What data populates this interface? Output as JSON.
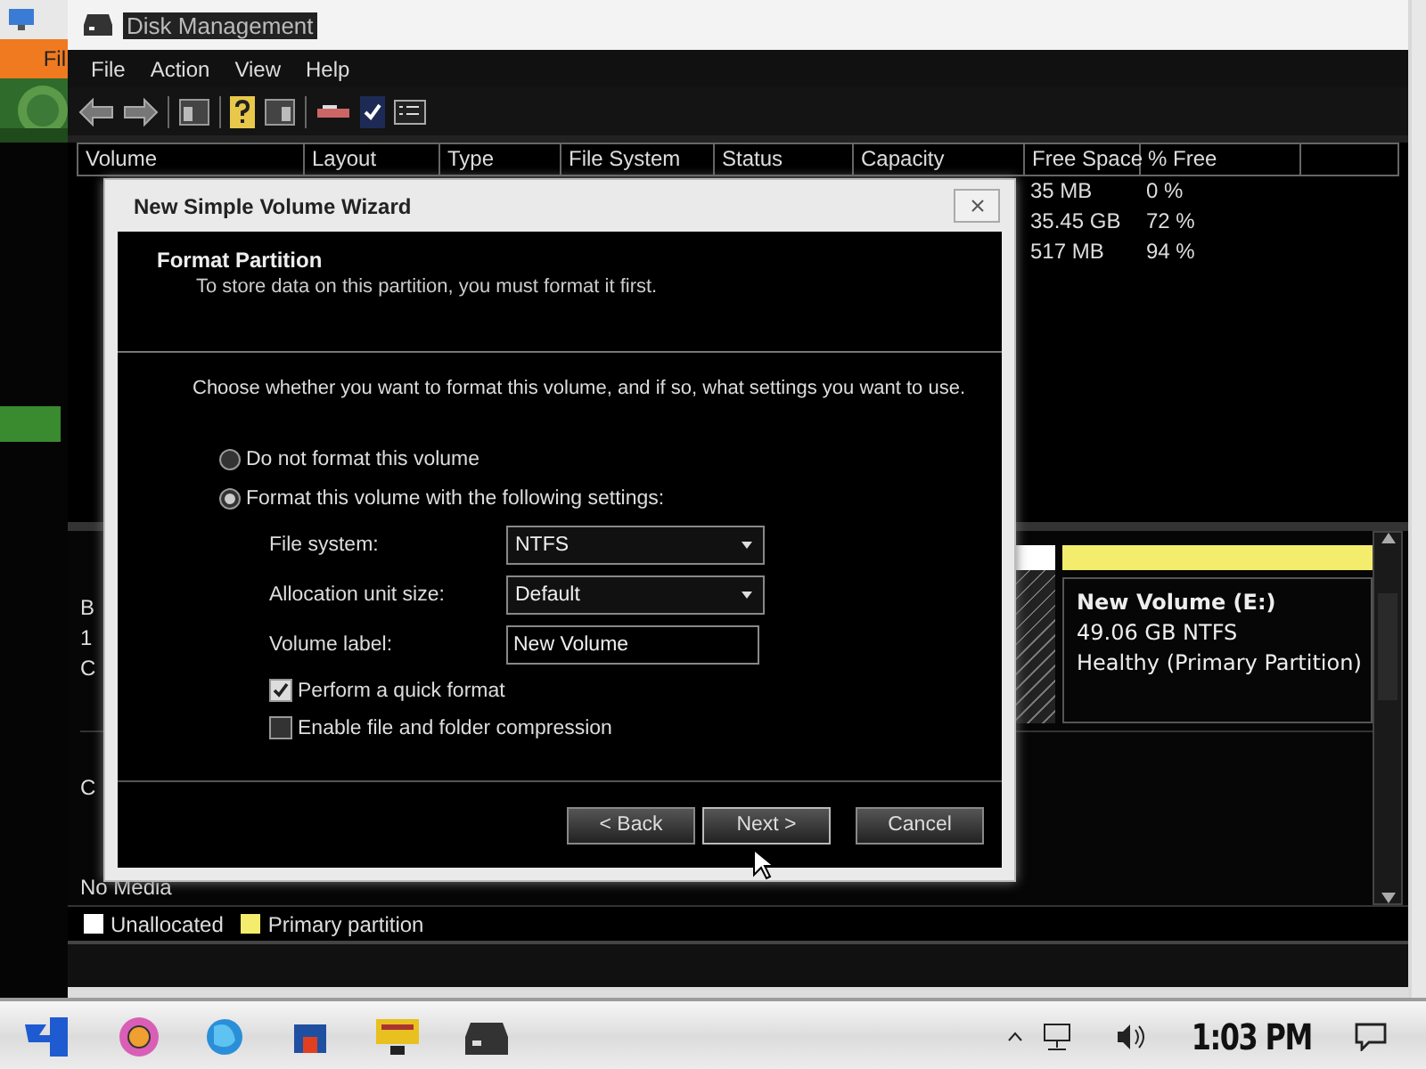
{
  "side_panel": {
    "tab_label": "Fil"
  },
  "window": {
    "title": "Disk Management"
  },
  "menu": [
    "File",
    "Action",
    "View",
    "Help"
  ],
  "volume_list": {
    "columns": [
      "Volume",
      "Layout",
      "Type",
      "File System",
      "Status",
      "Capacity",
      "Free Space",
      "% Free"
    ],
    "rows": [
      {
        "free_space": "35 MB",
        "percent_free": "0 %"
      },
      {
        "free_space": "35.45 GB",
        "percent_free": "72 %"
      },
      {
        "free_space": "517 MB",
        "percent_free": "94 %"
      }
    ]
  },
  "disks": [
    {
      "label_lines": [
        "B",
        "1",
        "C"
      ],
      "partitions": [
        {
          "kind": "unallocated"
        },
        {
          "kind": "primary",
          "name": "New Volume  (E:)",
          "size": "49.06 GB NTFS",
          "status": "Healthy (Primary Partition)"
        }
      ]
    },
    {
      "label_lines": [
        "C"
      ]
    }
  ],
  "no_media": "No Media",
  "legend": [
    {
      "label": "Unallocated",
      "color": "#ffffff"
    },
    {
      "label": "Primary partition",
      "color": "#f4ec6c"
    }
  ],
  "dialog": {
    "title": "New Simple Volume Wizard",
    "heading": "Format Partition",
    "subheading": "To store data on this partition, you must format it first.",
    "prompt": "Choose whether you want to format this volume, and if so, what settings you want to use.",
    "radios": [
      {
        "label": "Do not format this volume",
        "selected": false
      },
      {
        "label": "Format this volume with the following settings:",
        "selected": true
      }
    ],
    "settings": [
      {
        "kind": "dropdown",
        "label": "File system:",
        "value": "NTFS"
      },
      {
        "kind": "dropdown",
        "label": "Allocation unit size:",
        "value": "Default"
      },
      {
        "kind": "text",
        "label": "Volume label:",
        "value": "New Volume"
      }
    ],
    "checkboxes": [
      {
        "label": "Perform a quick format",
        "checked": true
      },
      {
        "label": "Enable file and folder compression",
        "checked": false
      }
    ],
    "buttons": [
      {
        "label": "< Back",
        "selected": false
      },
      {
        "label": "Next >",
        "selected": true
      },
      {
        "label": "Cancel",
        "selected": false
      }
    ]
  },
  "taskbar": {
    "clock": "1:03 PM"
  }
}
